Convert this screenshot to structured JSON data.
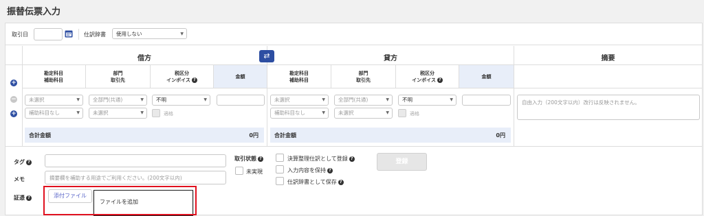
{
  "page": {
    "title": "振替伝票入力"
  },
  "topbar": {
    "date_label": "取引日",
    "journal_label": "仕訳辞書",
    "journal_value": "使用しない"
  },
  "debit": {
    "heading": "借方",
    "col_account": [
      "勘定科目",
      "補助科目"
    ],
    "col_dept": [
      "部門",
      "取引先"
    ],
    "col_tax": [
      "税区分",
      "インボイス"
    ],
    "col_amount": "金額",
    "account_value": "未選択",
    "sub_account_value": "補助科目なし",
    "dept_value": "全部門(共通)",
    "partner_value": "未選択",
    "tax_value": "不明",
    "qualified_label": "適格",
    "total_label": "合計金額",
    "total_value": "0円"
  },
  "credit": {
    "heading": "貸方",
    "col_account": [
      "勘定科目",
      "補助科目"
    ],
    "col_dept": [
      "部門",
      "取引先"
    ],
    "col_tax": [
      "税区分",
      "インボイス"
    ],
    "col_amount": "金額",
    "account_value": "未選択",
    "sub_account_value": "補助科目なし",
    "dept_value": "全部門(共通)",
    "partner_value": "未選択",
    "tax_value": "不明",
    "qualified_label": "適格",
    "total_label": "合計金額",
    "total_value": "0円"
  },
  "summary": {
    "heading": "摘要",
    "placeholder": "自由入力（200文字以内）改行は反映されません。"
  },
  "footer": {
    "tag_label": "タグ",
    "memo_label": "メモ",
    "memo_placeholder": "摘要欄を補助する用途でご利用ください。(200文字以内)",
    "evidence_label": "証憑",
    "status_label": "取引状態",
    "unrealized_label": "未実現",
    "settlement_label": "決算整理仕訳として登録",
    "keep_input_label": "入力内容を保持",
    "save_dict_label": "仕訳辞書として保存",
    "register_button": "登録",
    "attach_button": "添付ファイル",
    "add_file_label": "ファイルを追加"
  },
  "colors": {
    "accent": "#2d4ea2",
    "highlight": "#e0101e",
    "amount_bg": "#e8eef9"
  }
}
